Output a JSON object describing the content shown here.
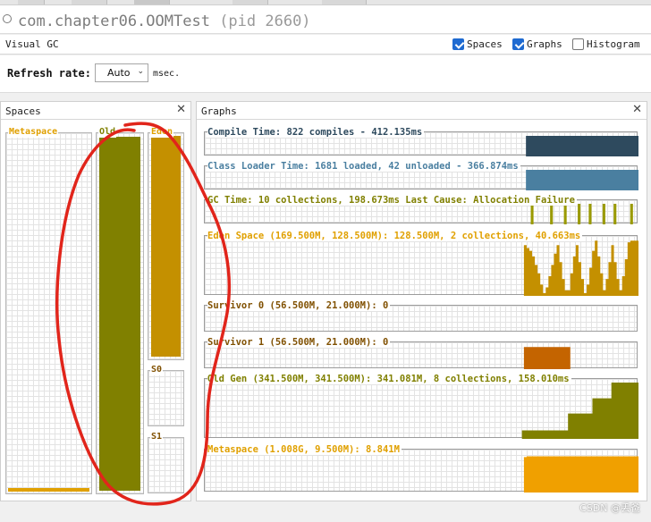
{
  "window": {
    "app_title": "com.chapter06.OOMTest",
    "pid_text": "(pid 2660)"
  },
  "visual_gc": {
    "label": "Visual GC",
    "options": [
      {
        "label": "Spaces",
        "checked": true
      },
      {
        "label": "Graphs",
        "checked": true
      },
      {
        "label": "Histogram",
        "checked": false
      }
    ]
  },
  "refresh": {
    "label": "Refresh rate:",
    "value": "Auto",
    "unit": "msec."
  },
  "spaces_panel": {
    "title": "Spaces",
    "spaces": [
      {
        "name": "Metaspace",
        "fill": 0.01,
        "color": "#e0a000",
        "label_color": "#e0a000"
      },
      {
        "name": "Old",
        "fill": 0.998,
        "color": "#808000",
        "label_color": "#808000"
      },
      {
        "name": "Eden",
        "fill": 1.0,
        "color": "#c49000",
        "label_color": "#e0a000"
      },
      {
        "name": "S0",
        "fill": 0.0,
        "color": "#c46400",
        "label_color": "#805000"
      },
      {
        "name": "S1",
        "fill": 0.0,
        "color": "#c46400",
        "label_color": "#805000"
      }
    ]
  },
  "graphs_panel": {
    "title": "Graphs",
    "graphs": [
      {
        "label": "Compile Time: 822 compiles - 412.135ms",
        "color": "#2e4a5e",
        "label_color": "#2e4a5e",
        "series": [
          0,
          0,
          0,
          0,
          0,
          0,
          0,
          0,
          0,
          0,
          0,
          0,
          0,
          0,
          0,
          0,
          0,
          0,
          0,
          0,
          0,
          0,
          0,
          0,
          0,
          0,
          0,
          0,
          0,
          0,
          0,
          0,
          0,
          0,
          0,
          0,
          0,
          0,
          0,
          0,
          0,
          0,
          0,
          0,
          0,
          0,
          0,
          0,
          0,
          0,
          0,
          0,
          0,
          0,
          0,
          0,
          0,
          0,
          0,
          0,
          0,
          0,
          0,
          0,
          0,
          0,
          0,
          0,
          0,
          0,
          0,
          0,
          0,
          0,
          0,
          0,
          0,
          0,
          0,
          0,
          0,
          0,
          0,
          0,
          0,
          0,
          0,
          0,
          0,
          0,
          0,
          0,
          0,
          0,
          0,
          0,
          0,
          0,
          0,
          0,
          0,
          0,
          0,
          0,
          0,
          0,
          0,
          0,
          0,
          0,
          0,
          0,
          0,
          0,
          0,
          0,
          0,
          1,
          1,
          1,
          1,
          1,
          1,
          1,
          1,
          1,
          1,
          1,
          1,
          1,
          1,
          1,
          1,
          1,
          1,
          1,
          1,
          1,
          1,
          1,
          1,
          1,
          1,
          1,
          1,
          1,
          1,
          1,
          1,
          1,
          1,
          1,
          1,
          1,
          1,
          1,
          1,
          1
        ]
      },
      {
        "label": "Class Loader Time: 1681 loaded, 42 unloaded - 366.874ms",
        "color": "#4a7fa0",
        "label_color": "#4a7fa0",
        "series": [
          0,
          0,
          0,
          0,
          0,
          0,
          0,
          0,
          0,
          0,
          0,
          0,
          0,
          0,
          0,
          0,
          0,
          0,
          0,
          0,
          0,
          0,
          0,
          0,
          0,
          0,
          0,
          0,
          0,
          0,
          0,
          0,
          0,
          0,
          0,
          0,
          0,
          0,
          0,
          0,
          0,
          0,
          0,
          0,
          0,
          0,
          0,
          0,
          0,
          0,
          0,
          0,
          0,
          0,
          0,
          0,
          0,
          0,
          0,
          0,
          0,
          0,
          0,
          0,
          0,
          0,
          0,
          0,
          0,
          0,
          0,
          0,
          0,
          0,
          0,
          0,
          0,
          0,
          0,
          0,
          0,
          0,
          0,
          0,
          0,
          0,
          0,
          0,
          0,
          0,
          0,
          0,
          0,
          0,
          0,
          0,
          0,
          0,
          0,
          0,
          0,
          0,
          0,
          0,
          0,
          0,
          0,
          0,
          0,
          0,
          0,
          0,
          0,
          0,
          0,
          0,
          0,
          1,
          1,
          1,
          1,
          1,
          1,
          1,
          1,
          1,
          1,
          1,
          1,
          1,
          1,
          1,
          1,
          1,
          1,
          1,
          1,
          1,
          1,
          1,
          1,
          1,
          1,
          1,
          1,
          1,
          1,
          1,
          1,
          1,
          1,
          1,
          1,
          1,
          1,
          1,
          1,
          1
        ]
      },
      {
        "label": "GC Time: 10 collections, 198.673ms Last Cause: Allocation Failure",
        "color": "#9a9a00",
        "label_color": "#808000",
        "series": [
          0,
          0,
          0,
          0,
          0,
          0,
          0,
          0,
          0,
          0,
          0,
          0,
          0,
          0,
          0,
          0,
          0,
          0,
          0,
          0,
          0,
          0,
          0,
          0,
          0,
          0,
          0,
          0,
          0,
          0,
          0,
          0,
          0,
          0,
          0,
          0,
          0,
          0,
          0,
          0,
          0,
          0,
          0,
          0,
          0,
          0,
          0,
          0,
          0,
          0,
          0,
          0,
          0,
          0,
          0,
          0,
          0,
          0,
          0,
          0,
          0,
          0,
          0,
          0,
          0,
          0,
          0,
          0,
          0,
          0,
          0,
          0,
          0,
          0,
          0,
          0,
          0,
          0,
          0,
          0,
          0,
          0,
          0,
          0,
          0,
          0,
          0,
          0,
          0,
          0,
          0,
          0,
          0,
          0,
          0,
          0,
          0,
          0,
          0,
          0,
          0,
          0,
          0,
          0,
          0,
          0,
          0,
          0,
          0,
          0,
          0,
          0,
          0,
          0,
          0,
          0,
          0,
          0,
          1,
          0,
          0,
          0,
          0,
          0,
          0,
          1,
          0,
          0,
          0,
          0,
          1,
          0,
          0,
          0,
          0,
          1,
          0,
          0,
          0,
          1,
          0,
          0,
          0,
          0,
          1,
          0,
          0,
          0,
          1,
          0,
          0,
          0,
          0,
          0,
          1,
          0,
          0
        ]
      },
      {
        "label": "Eden Space (169.500M, 128.500M): 128.500M, 2 collections, 40.663ms",
        "color": "#c49000",
        "label_color": "#e0a000",
        "series": [
          0,
          0,
          0,
          0,
          0,
          0,
          0,
          0,
          0,
          0,
          0,
          0,
          0,
          0,
          0,
          0,
          0,
          0,
          0,
          0,
          0,
          0,
          0,
          0,
          0,
          0,
          0,
          0,
          0,
          0,
          0,
          0,
          0,
          0,
          0,
          0,
          0,
          0,
          0,
          0,
          0,
          0,
          0,
          0,
          0,
          0,
          0,
          0,
          0,
          0,
          0,
          0,
          0,
          0,
          0,
          0,
          0,
          0,
          0,
          0,
          0,
          0,
          0,
          0,
          0,
          0,
          0,
          0,
          0,
          0,
          0,
          0,
          0,
          0,
          0,
          0,
          0,
          0,
          0,
          0,
          0,
          0,
          0,
          0,
          0,
          0,
          0,
          0,
          0,
          0,
          0,
          0,
          0,
          0,
          0,
          0,
          0,
          0,
          0,
          0,
          0,
          0,
          0,
          0,
          0,
          0,
          0,
          0,
          0,
          0,
          0,
          0,
          0,
          0,
          0,
          0,
          0,
          0.9,
          0.85,
          0.8,
          0.7,
          0.55,
          0.4,
          0.2,
          0.05,
          0.15,
          0.35,
          0.55,
          0.75,
          0.9,
          0.6,
          0.3,
          0.1,
          0.1,
          0.4,
          0.7,
          0.9,
          0.6,
          0.3,
          0.05,
          0.2,
          0.5,
          0.8,
          0.98,
          0.7,
          0.4,
          0.1,
          0.3,
          0.6,
          0.9,
          0.6,
          0.3,
          0.1,
          0.35,
          0.65,
          0.95,
          0.98,
          0.98,
          0.98
        ]
      },
      {
        "label": "Survivor 0 (56.500M, 21.000M): 0",
        "color": "#c46400",
        "label_color": "#805000",
        "series": []
      },
      {
        "label": "Survivor 1 (56.500M, 21.000M): 0",
        "color": "#c46400",
        "label_color": "#805000",
        "series": [
          0,
          0,
          0,
          0,
          0,
          0,
          0,
          0,
          0,
          0,
          0,
          0,
          0,
          0,
          0,
          0,
          0,
          0,
          0,
          0,
          0,
          0,
          0,
          0,
          0,
          0,
          0,
          0,
          0,
          0,
          0,
          0,
          0,
          0,
          0,
          0,
          0,
          0,
          0,
          0,
          0,
          0,
          0,
          0,
          0,
          0,
          0,
          0,
          0,
          0,
          0,
          0,
          0,
          0,
          0,
          0,
          0,
          0,
          0,
          0,
          0,
          0,
          0,
          0,
          0,
          0,
          0,
          0,
          0,
          0,
          0,
          0,
          0,
          0,
          0,
          0,
          0,
          0,
          0,
          0,
          0,
          0,
          0,
          0,
          0,
          0,
          0,
          0,
          0,
          0,
          0,
          0,
          0,
          0,
          0,
          0,
          0,
          0,
          0,
          0,
          0,
          0,
          0,
          0,
          0,
          0,
          0,
          0,
          0,
          0,
          0,
          0,
          0,
          0,
          0,
          0,
          0,
          0.95,
          0.95,
          0.95,
          0.95,
          0.95,
          0.95,
          0.95,
          0.95,
          0.95,
          0.95,
          0.95,
          0.95,
          0.95,
          0.95,
          0.95,
          0.95,
          0.95,
          0,
          0,
          0,
          0,
          0,
          0,
          0,
          0,
          0,
          0,
          0,
          0,
          0,
          0,
          0,
          0,
          0,
          0,
          0,
          0,
          0,
          0,
          0,
          0,
          0
        ]
      },
      {
        "label": "Old Gen (341.500M, 341.500M): 341.081M, 8 collections, 158.010ms",
        "color": "#808000",
        "label_color": "#808000",
        "series": [
          0,
          0,
          0,
          0,
          0,
          0,
          0,
          0,
          0,
          0,
          0,
          0,
          0,
          0,
          0,
          0,
          0,
          0,
          0,
          0,
          0,
          0,
          0,
          0,
          0,
          0,
          0,
          0,
          0,
          0,
          0,
          0,
          0,
          0,
          0,
          0,
          0,
          0,
          0,
          0,
          0,
          0,
          0,
          0,
          0,
          0,
          0,
          0,
          0,
          0,
          0,
          0,
          0,
          0,
          0,
          0,
          0,
          0,
          0,
          0,
          0,
          0,
          0,
          0,
          0,
          0,
          0,
          0,
          0,
          0,
          0,
          0,
          0,
          0,
          0,
          0,
          0,
          0,
          0,
          0,
          0,
          0,
          0,
          0,
          0,
          0,
          0,
          0,
          0,
          0,
          0,
          0,
          0,
          0,
          0,
          0,
          0,
          0,
          0,
          0,
          0,
          0,
          0,
          0,
          0,
          0,
          0,
          0,
          0,
          0,
          0,
          0,
          0,
          0,
          0,
          0,
          0,
          0.15,
          0.15,
          0.15,
          0.15,
          0.15,
          0.15,
          0.15,
          0.15,
          0.15,
          0.15,
          0.15,
          0.15,
          0.15,
          0.15,
          0.15,
          0.15,
          0.15,
          0.45,
          0.45,
          0.45,
          0.45,
          0.45,
          0.45,
          0.45,
          0.45,
          0.45,
          0.72,
          0.72,
          0.72,
          0.72,
          0.72,
          0.72,
          0.72,
          1,
          1,
          1,
          1,
          1,
          1,
          1,
          1,
          1,
          1
        ]
      },
      {
        "label": "Metaspace (1.008G, 9.500M): 8.841M",
        "color": "#f0a000",
        "label_color": "#e0a000",
        "series": [
          0,
          0,
          0,
          0,
          0,
          0,
          0,
          0,
          0,
          0,
          0,
          0,
          0,
          0,
          0,
          0,
          0,
          0,
          0,
          0,
          0,
          0,
          0,
          0,
          0,
          0,
          0,
          0,
          0,
          0,
          0,
          0,
          0,
          0,
          0,
          0,
          0,
          0,
          0,
          0,
          0,
          0,
          0,
          0,
          0,
          0,
          0,
          0,
          0,
          0,
          0,
          0,
          0,
          0,
          0,
          0,
          0,
          0,
          0,
          0,
          0,
          0,
          0,
          0,
          0,
          0,
          0,
          0,
          0,
          0,
          0,
          0,
          0,
          0,
          0,
          0,
          0,
          0,
          0,
          0,
          0,
          0,
          0,
          0,
          0,
          0,
          0,
          0,
          0,
          0,
          0,
          0,
          0,
          0,
          0,
          0,
          0,
          0,
          0,
          0,
          0,
          0,
          0,
          0,
          0,
          0,
          0,
          0,
          0,
          0,
          0,
          0,
          0,
          0,
          0,
          0,
          0,
          0.9,
          0.92,
          0.92,
          0.92,
          0.92,
          0.92,
          0.92,
          0.92,
          0.92,
          0.92,
          0.92,
          0.92,
          0.92,
          0.92,
          0.92,
          0.92,
          0.92,
          0.92,
          0.92,
          0.92,
          0.92,
          0.92,
          0.92,
          0.92,
          0.92,
          0.92,
          0.92,
          0.92,
          0.92,
          0.92,
          0.92,
          0.92,
          0.92,
          0.92,
          0.92,
          0.92,
          0.92,
          0.92,
          0.92,
          0.92,
          0.92,
          0.92
        ]
      }
    ]
  },
  "watermark": "CSDN @丢爸"
}
